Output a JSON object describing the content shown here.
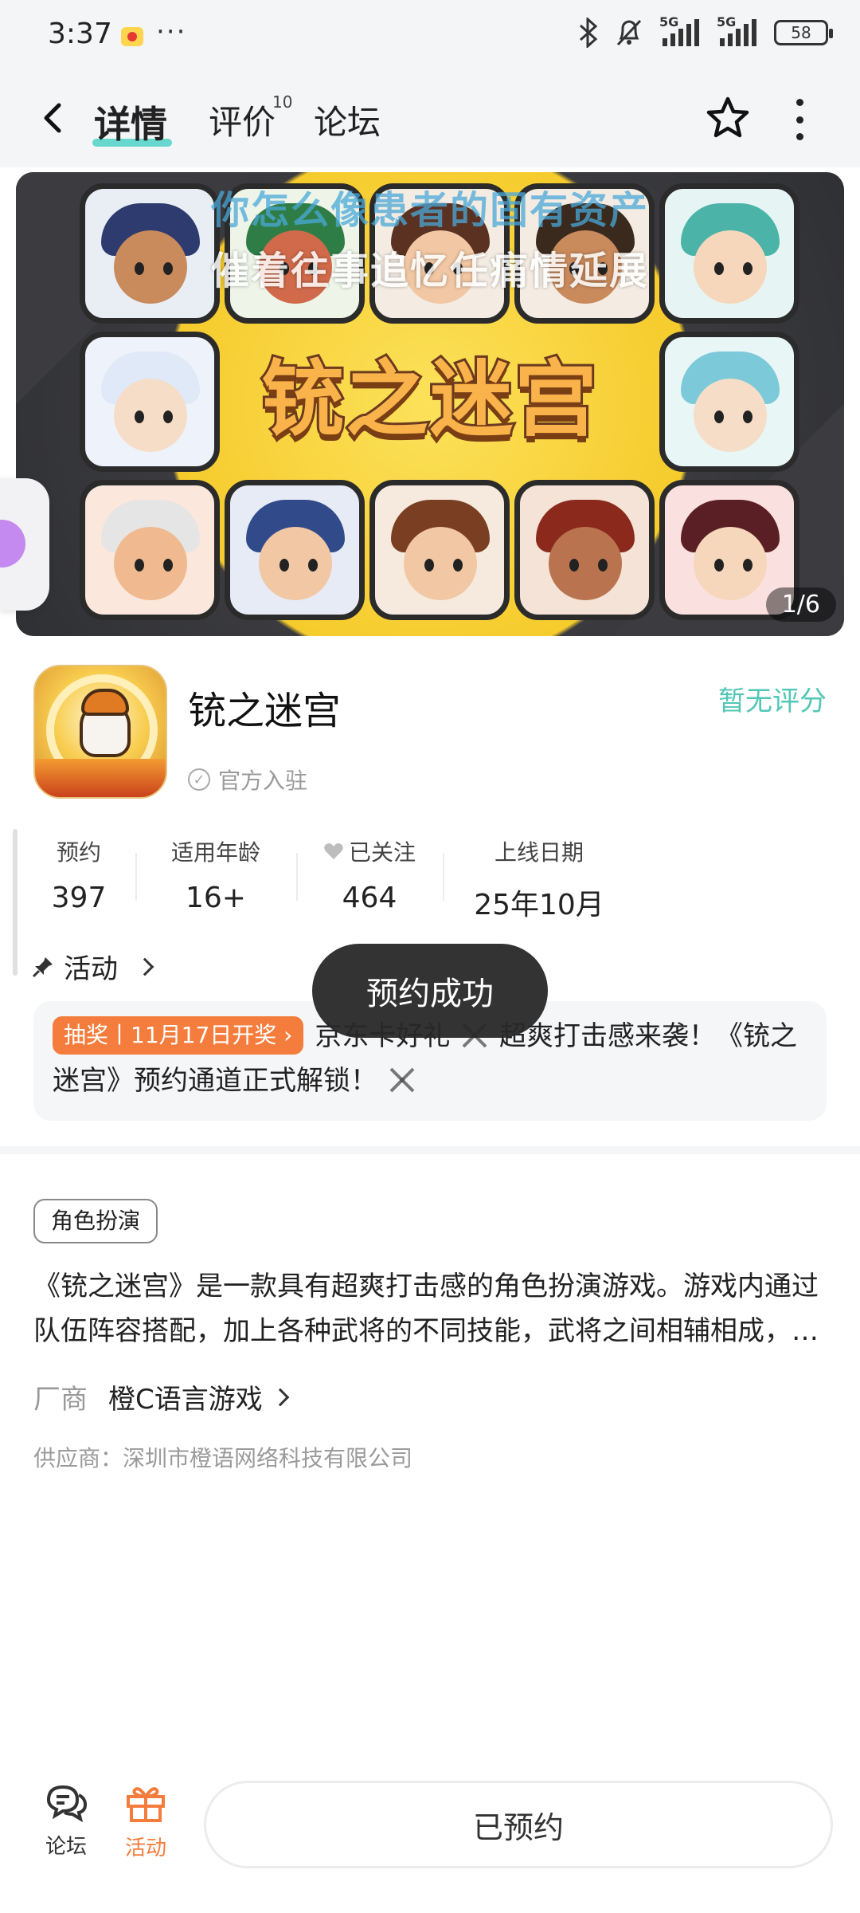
{
  "status_bar": {
    "time": "3:37",
    "more": "···",
    "network_1": "5G",
    "network_2": "5G",
    "battery": "58"
  },
  "nav": {
    "tabs": [
      {
        "label": "详情",
        "active": true
      },
      {
        "label": "评价",
        "badge": "10"
      },
      {
        "label": "论坛"
      }
    ]
  },
  "banner": {
    "overlay_line_1": "你怎么像患者的固有资产",
    "overlay_line_2": "催着往事追忆任痛情延展",
    "title": "铳之迷宫",
    "counter": "1/6"
  },
  "game": {
    "name": "铳之迷宫",
    "verified_label": "官方入驻",
    "rating": "暂无评分"
  },
  "stats": [
    {
      "label": "预约",
      "value": "397"
    },
    {
      "label": "适用年龄",
      "value": "16+"
    },
    {
      "label": "已关注",
      "value": "464"
    },
    {
      "label": "上线日期",
      "value": "25年10月"
    }
  ],
  "activity": {
    "header": "活动",
    "tag": "抽奖丨11月17日开奖",
    "text_1": "京东卡好礼",
    "text_2": "超爽打击感来袭！《铳之迷宫》预约通道正式解锁！"
  },
  "toast": "预约成功",
  "details": {
    "genre_tag": "角色扮演",
    "description": "《铳之迷宫》是一款具有超爽打击感的角色扮演游戏。游戏内通过队伍阵容搭配，加上各种武将的不同技能，武将之间相辅相成，打造专属于你的无敌阵容。",
    "vendor_label": "厂商",
    "vendor_name": "橙C语言游戏",
    "supplier": "供应商：深圳市橙语网络科技有限公司"
  },
  "bottom_bar": {
    "forum_label": "论坛",
    "activity_label": "活动",
    "reserve_label": "已预约"
  },
  "colors": {
    "accent_teal": "#52c7b5",
    "accent_orange": "#f47c3c",
    "toast_bg": "#282828"
  }
}
